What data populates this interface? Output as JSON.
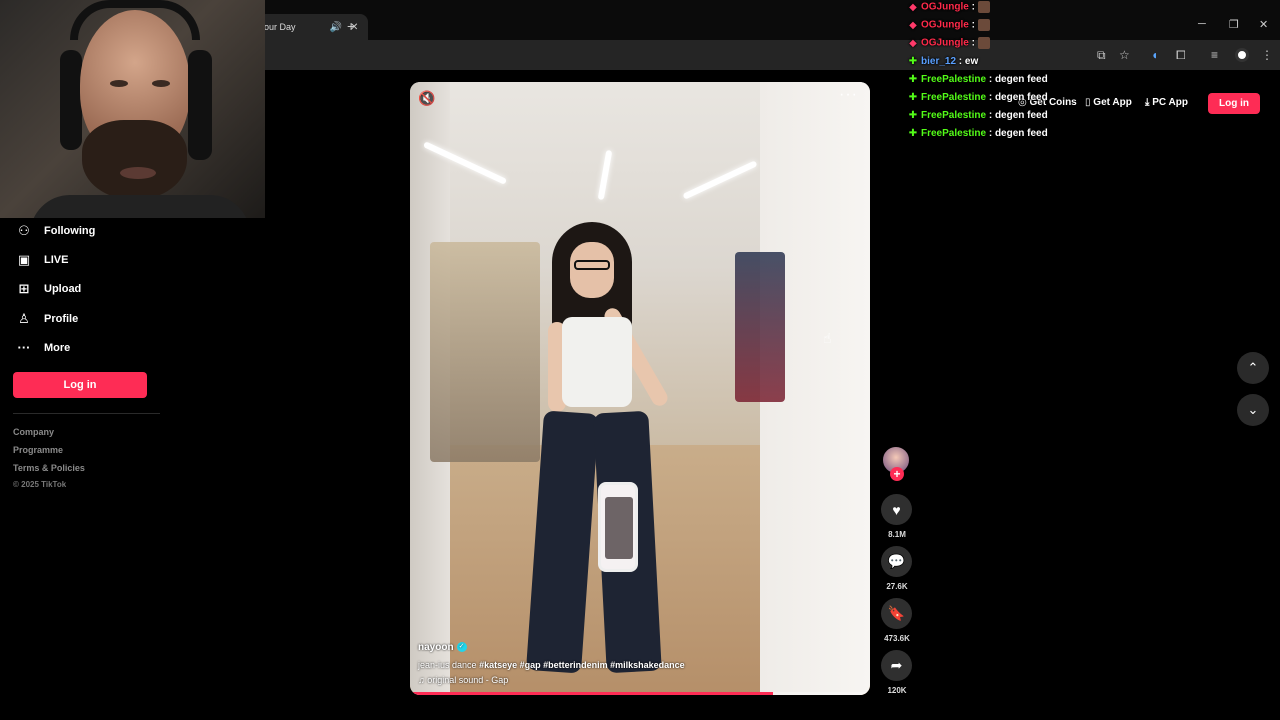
{
  "browser": {
    "tab_title": "our Day",
    "new_tab": "+",
    "minimize": "─",
    "restore": "❐",
    "close": "✕"
  },
  "sidebar": {
    "items": [
      {
        "label": "Following",
        "icon": "following-icon",
        "glyph": "⚇"
      },
      {
        "label": "LIVE",
        "icon": "live-icon",
        "glyph": "▣"
      },
      {
        "label": "Upload",
        "icon": "upload-icon",
        "glyph": "⊞"
      },
      {
        "label": "Profile",
        "icon": "profile-icon",
        "glyph": "♙"
      },
      {
        "label": "More",
        "icon": "more-icon",
        "glyph": "···"
      }
    ],
    "login_label": "Log in",
    "footer_links": [
      "Company",
      "Programme",
      "Terms & Policies"
    ],
    "copyright": "© 2025 TikTok"
  },
  "header": {
    "get_coins": "Get Coins",
    "get_app": "Get App",
    "pc_app": "PC App",
    "login_label": "Log in"
  },
  "video": {
    "author": "nayoon",
    "caption_text": "jean-ius dance",
    "hashtags": "#katseye  #gap  #betterindenim  #milkshakedance",
    "sound": "original sound - Gap",
    "progress_fraction": 0.79
  },
  "actions": {
    "likes": "8.1M",
    "comments": "27.6K",
    "saves": "473.6K",
    "shares": "120K"
  },
  "chat": [
    {
      "user": "OGJungle",
      "color": "#ff2a4a",
      "badge": "◆",
      "badge_color": "#ff3a6a",
      "message": "",
      "emote": true
    },
    {
      "user": "OGJungle",
      "color": "#ff2a4a",
      "badge": "◆",
      "badge_color": "#ff3a6a",
      "message": "",
      "emote": true
    },
    {
      "user": "OGJungle",
      "color": "#ff2a4a",
      "badge": "◆",
      "badge_color": "#ff3a6a",
      "message": "",
      "emote": true
    },
    {
      "user": "bier_12",
      "color": "#5aa0ff",
      "badge": "✚",
      "badge_color": "#53fc18",
      "message": "ew",
      "emote": false
    },
    {
      "user": "FreePalestine",
      "color": "#53fc18",
      "badge": "✚",
      "badge_color": "#53fc18",
      "message": "degen feed",
      "emote": false
    },
    {
      "user": "FreePalestine",
      "color": "#53fc18",
      "badge": "✚",
      "badge_color": "#53fc18",
      "message": "degen feed",
      "emote": false
    },
    {
      "user": "FreePalestine",
      "color": "#53fc18",
      "badge": "✚",
      "badge_color": "#53fc18",
      "message": "degen feed",
      "emote": false
    },
    {
      "user": "FreePalestine",
      "color": "#53fc18",
      "badge": "✚",
      "badge_color": "#53fc18",
      "message": "degen feed",
      "emote": false
    }
  ],
  "colors": {
    "accent": "#fe2c55",
    "kick_green": "#53fc18"
  }
}
